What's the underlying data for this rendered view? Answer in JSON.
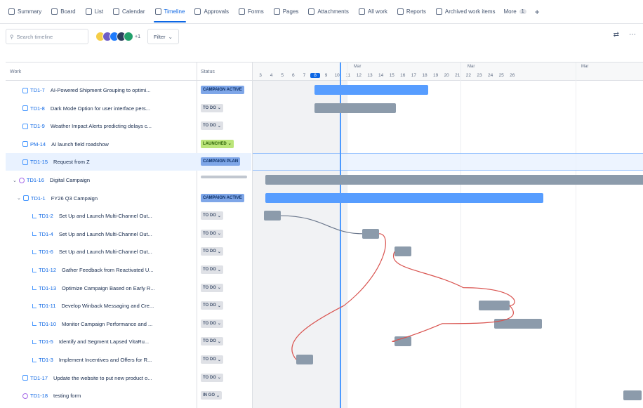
{
  "nav": {
    "tabs": [
      {
        "label": "Summary",
        "icon": "globe-icon"
      },
      {
        "label": "Board",
        "icon": "board-icon"
      },
      {
        "label": "List",
        "icon": "list-icon"
      },
      {
        "label": "Calendar",
        "icon": "calendar-icon"
      },
      {
        "label": "Timeline",
        "icon": "timeline-icon",
        "active": true
      },
      {
        "label": "Approvals",
        "icon": "approvals-icon"
      },
      {
        "label": "Forms",
        "icon": "forms-icon"
      },
      {
        "label": "Pages",
        "icon": "pages-icon"
      },
      {
        "label": "Attachments",
        "icon": "paperclip-icon"
      },
      {
        "label": "All work",
        "icon": "all-work-icon"
      },
      {
        "label": "Reports",
        "icon": "chart-icon"
      },
      {
        "label": "Archived work items",
        "icon": "archive-icon"
      }
    ],
    "more_label": "More",
    "more_count": "1",
    "add_label": "+"
  },
  "toolbar": {
    "search_placeholder": "Search timeline",
    "avatar_count": "+1",
    "filter_label": "Filter"
  },
  "columns": {
    "work": "Work",
    "status": "Status"
  },
  "timeline": {
    "months": [
      "Mar",
      "Mar",
      "Mar"
    ],
    "days": [
      "3",
      "4",
      "5",
      "6",
      "7",
      "8",
      "9",
      "10",
      "11",
      "12",
      "13",
      "14",
      "15",
      "16",
      "17",
      "18",
      "19",
      "20",
      "21",
      "22",
      "23",
      "24",
      "25",
      "26"
    ],
    "selected_day": "8"
  },
  "rows": [
    {
      "key": "TD1-7",
      "summary": "AI-Powered Shipment Grouping to optimi...",
      "status": "CAMPAIGN ACTIVE",
      "type": "task",
      "indent": 0
    },
    {
      "key": "TD1-8",
      "summary": "Dark Mode Option for user interface pers...",
      "status": "TO DO",
      "type": "task",
      "indent": 0
    },
    {
      "key": "TD1-9",
      "summary": "Weather Impact Alerts predicting delays c...",
      "status": "TO DO",
      "type": "task",
      "indent": 0
    },
    {
      "key": "PM-14",
      "summary": "AI launch field roadshow",
      "status": "LAUNCHED",
      "type": "task",
      "indent": 0
    },
    {
      "key": "TD1-15",
      "summary": "Request from Z",
      "status": "CAMPAIGN PLAN",
      "type": "task",
      "indent": 0,
      "selected": true
    },
    {
      "key": "TD1-16",
      "summary": "Digital Campaign",
      "status": "",
      "type": "epic",
      "indent": 0
    },
    {
      "key": "TD1-1",
      "summary": "FY26 Q3 Campaign",
      "status": "CAMPAIGN ACTIVE",
      "type": "task",
      "indent": 1
    },
    {
      "key": "TD1-2",
      "summary": "Set Up and Launch Multi-Channel Out...",
      "status": "TO DO",
      "type": "sub",
      "indent": 2
    },
    {
      "key": "TD1-4",
      "summary": "Set Up and Launch Multi-Channel Out...",
      "status": "TO DO",
      "type": "sub",
      "indent": 2
    },
    {
      "key": "TD1-6",
      "summary": "Set Up and Launch Multi-Channel Out...",
      "status": "TO DO",
      "type": "sub",
      "indent": 2
    },
    {
      "key": "TD1-12",
      "summary": "Gather Feedback from Reactivated U...",
      "status": "TO DO",
      "type": "sub",
      "indent": 2
    },
    {
      "key": "TD1-13",
      "summary": "Optimize Campaign Based on Early R...",
      "status": "TO DO",
      "type": "sub",
      "indent": 2
    },
    {
      "key": "TD1-11",
      "summary": "Develop Winback Messaging and Cre...",
      "status": "TO DO",
      "type": "sub",
      "indent": 2
    },
    {
      "key": "TD1-10",
      "summary": "Monitor Campaign Performance and ...",
      "status": "TO DO",
      "type": "sub",
      "indent": 2
    },
    {
      "key": "TD1-5",
      "summary": "Identify and Segment Lapsed VitaRu...",
      "status": "TO DO",
      "type": "sub",
      "indent": 2
    },
    {
      "key": "TD1-3",
      "summary": "Implement Incentives and Offers for R...",
      "status": "TO DO",
      "type": "sub",
      "indent": 2
    },
    {
      "key": "TD1-17",
      "summary": "Update the website to put new product o...",
      "status": "TO DO",
      "type": "task",
      "indent": 0
    },
    {
      "key": "TD1-18",
      "summary": "testing form",
      "status": "IN GO",
      "type": "epic",
      "indent": 0
    }
  ],
  "colors": {
    "accent": "#0c66e4",
    "bar_blue": "#579dff",
    "bar_grey": "#8c9bab",
    "dependency_red": "#d9534f"
  }
}
